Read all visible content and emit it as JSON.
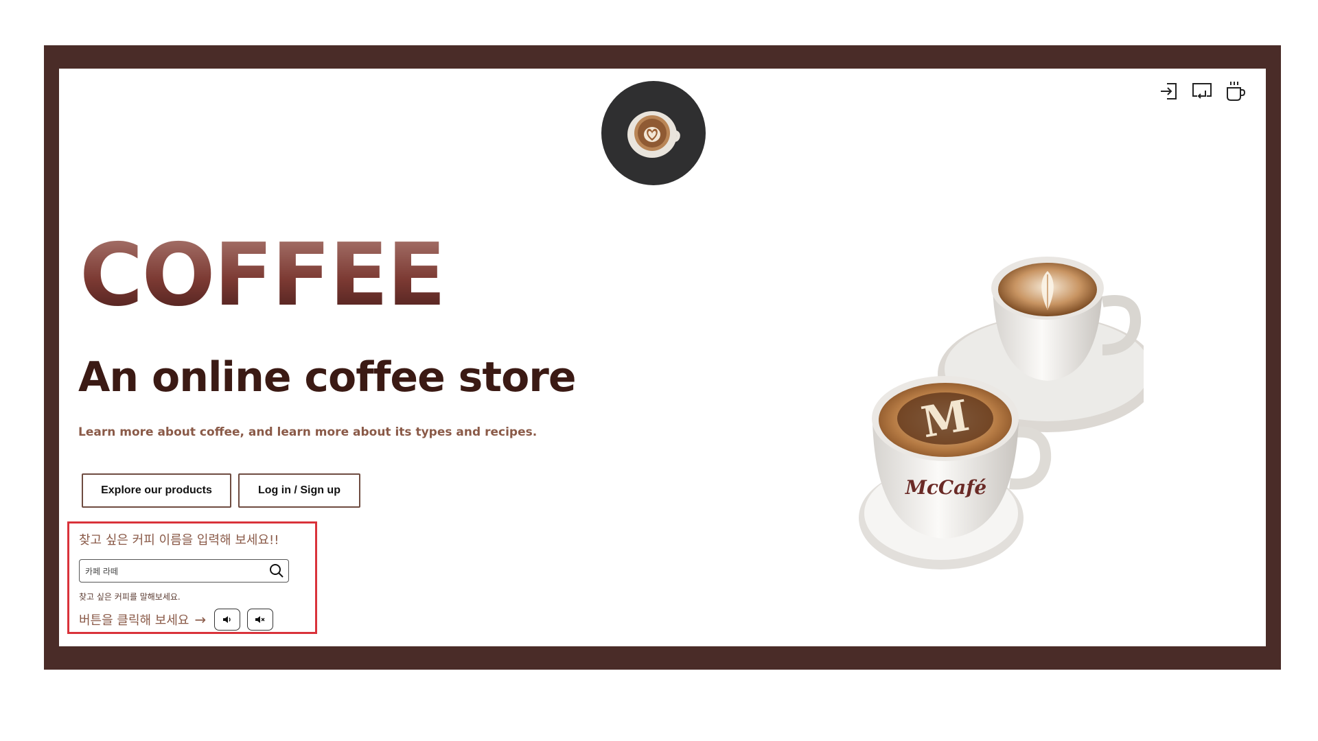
{
  "header": {
    "logo_icon": "latte-cup-icon",
    "actions": [
      {
        "name": "login-icon"
      },
      {
        "name": "return-icon"
      },
      {
        "name": "coffee-cup-icon"
      }
    ]
  },
  "hero": {
    "title": "COFFEE",
    "subtitle": "An online coffee store",
    "description": "Learn more about coffee, and learn more about its types and recipes."
  },
  "buttons": {
    "explore": "Explore our products",
    "login": "Log in / Sign up"
  },
  "search": {
    "title": "찾고 싶은 커피 이름을 입력해 보세요!!",
    "value": "카페 라떼",
    "hint": "찾고 싶은 커피를 말해보세요.",
    "voice_label": "버튼을 클릭해 보세요",
    "arrow": "→"
  },
  "image": {
    "brand_text": "McCafé",
    "cup_letter": "M"
  },
  "colors": {
    "frame": "#4a2c28",
    "title_gradient_top": "#a9776f",
    "title_gradient_bottom": "#4a1e1c",
    "subtitle": "#3b1a14",
    "muted": "#8a5a48",
    "highlight_border": "#d9323a",
    "logo_bg": "#2f2f30"
  }
}
